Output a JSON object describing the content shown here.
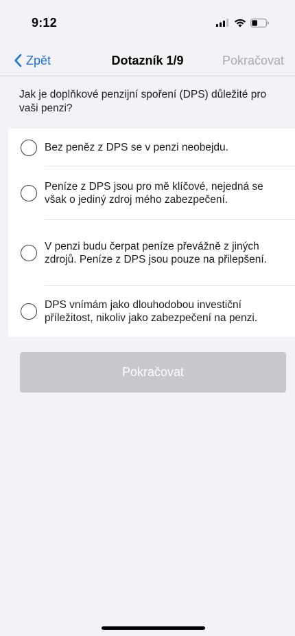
{
  "status_bar": {
    "time": "9:12",
    "icons": [
      "signal-icon",
      "wifi-icon",
      "battery-icon"
    ]
  },
  "nav": {
    "back_label": "Zpět",
    "title": "Dotazník 1/9",
    "next_label": "Pokračovat",
    "back_color": "#1f6fd6",
    "next_color": "#a9a9ae"
  },
  "question": "Jak je doplňkové penzijní spoření (DPS) důležité pro vaši penzi?",
  "options": [
    {
      "label": "Bez peněz z DPS se v penzi neobejdu.",
      "selected": false
    },
    {
      "label": "Peníze z DPS jsou pro mě klíčové, nejedná se však o jediný zdroj mého zabezpečení.",
      "selected": false
    },
    {
      "label": "V penzi budu čerpat peníze převážně z jiných zdrojů. Peníze z DPS jsou pouze na přilepšení.",
      "selected": false
    },
    {
      "label": "DPS vnímám jako dlouhodobou investiční příležitost, nikoliv jako zabezpečení na penzi.",
      "selected": false
    }
  ],
  "continue_button": {
    "label": "Pokračovat",
    "disabled": true
  }
}
